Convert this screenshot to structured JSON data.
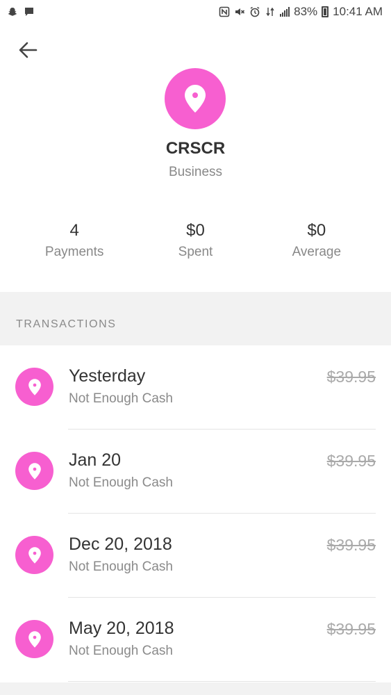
{
  "colors": {
    "accent": "#f75fd0",
    "text": "#333333",
    "muted": "#888888"
  },
  "status_bar": {
    "battery": "83%",
    "time": "10:41 AM",
    "left_icons": [
      "snapchat-icon",
      "message-icon"
    ],
    "right_icons": [
      "nfc-icon",
      "mute-icon",
      "alarm-icon",
      "data-icon",
      "signal-icon",
      "battery-icon"
    ]
  },
  "header": {
    "back_icon": "arrow-left-icon"
  },
  "merchant": {
    "name": "CRSCR",
    "type": "Business",
    "icon": "location-pin-icon"
  },
  "stats": [
    {
      "value": "4",
      "label": "Payments"
    },
    {
      "value": "$0",
      "label": "Spent"
    },
    {
      "value": "$0",
      "label": "Average"
    }
  ],
  "transactions_section": {
    "title": "TRANSACTIONS",
    "items": [
      {
        "date": "Yesterday",
        "status": "Not Enough Cash",
        "amount": "$39.95"
      },
      {
        "date": "Jan 20",
        "status": "Not Enough Cash",
        "amount": "$39.95"
      },
      {
        "date": "Dec 20, 2018",
        "status": "Not Enough Cash",
        "amount": "$39.95"
      },
      {
        "date": "May 20, 2018",
        "status": "Not Enough Cash",
        "amount": "$39.95"
      }
    ]
  }
}
